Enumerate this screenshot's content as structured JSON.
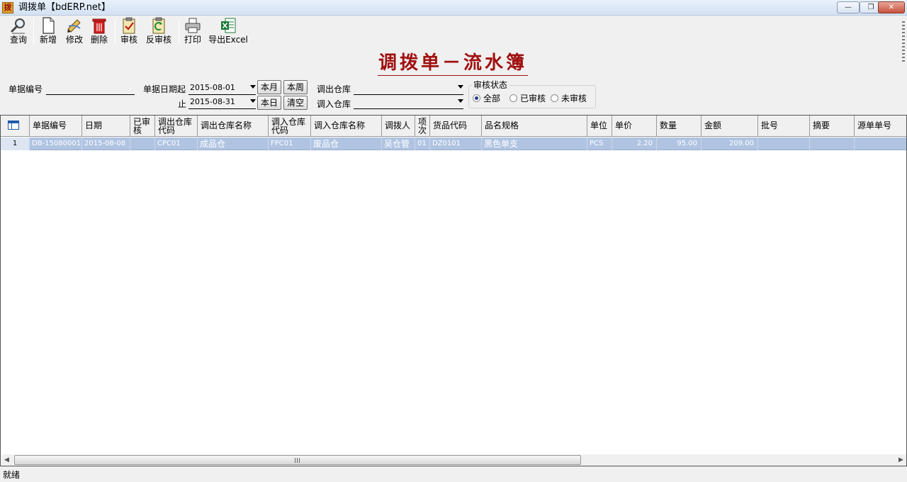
{
  "window": {
    "title": "调拨单【bdERP.net】",
    "icon_text": "拨",
    "min_glyph": "—",
    "max_glyph": "❐",
    "close_glyph": "✕"
  },
  "toolbar": {
    "query": "查询",
    "add": "新增",
    "edit": "修改",
    "delete": "删除",
    "approve": "审核",
    "unapprove": "反审核",
    "print": "打印",
    "export": "导出Excel"
  },
  "report_title": "调拨单－流水簿",
  "filters": {
    "doc_no_label": "单据编号",
    "date_from_label": "单据日期起",
    "date_to_label": "止",
    "date_from": "2015-08-01",
    "date_to": "2015-08-31",
    "btn_this_month": "本月",
    "btn_this_week": "本周",
    "btn_today": "本日",
    "btn_clear": "清空",
    "out_wh_label": "调出仓库",
    "in_wh_label": "调入仓库",
    "status_group": "审核状态",
    "status_all": "全部",
    "status_approved": "已审核",
    "status_unapproved": "未审核",
    "status_selected": "全部"
  },
  "grid": {
    "headers": {
      "doc_no": "单据编号",
      "date": "日期",
      "approved_1": "已审",
      "approved_2": "核",
      "out_code_1": "调出仓库",
      "out_code_2": "代码",
      "out_name": "调出仓库名称",
      "in_code_1": "调入仓库",
      "in_code_2": "代码",
      "in_name": "调入仓库名称",
      "handler": "调拨人",
      "item_1": "项",
      "item_2": "次",
      "goods_code": "货品代码",
      "goods_name": "品名规格",
      "unit": "单位",
      "price": "单价",
      "qty": "数量",
      "amount": "金额",
      "batch": "批号",
      "summary": "摘要",
      "source_no": "源单单号"
    },
    "rows": [
      {
        "row_no": "1",
        "doc_no": "DB-15080001",
        "date": "2015-08-08",
        "approved": "",
        "out_code": "CPC01",
        "out_name": "成品仓",
        "in_code": "FPC01",
        "in_name": "废品仓",
        "handler": "吴仓管",
        "item": "01",
        "goods_code": "DZ0101",
        "goods_name": "黑色单支",
        "unit": "PCS",
        "price": "2.20",
        "qty": "95.00",
        "amount": "209.00",
        "batch": "",
        "summary": "",
        "source_no": ""
      }
    ]
  },
  "status_bar": "就绪"
}
